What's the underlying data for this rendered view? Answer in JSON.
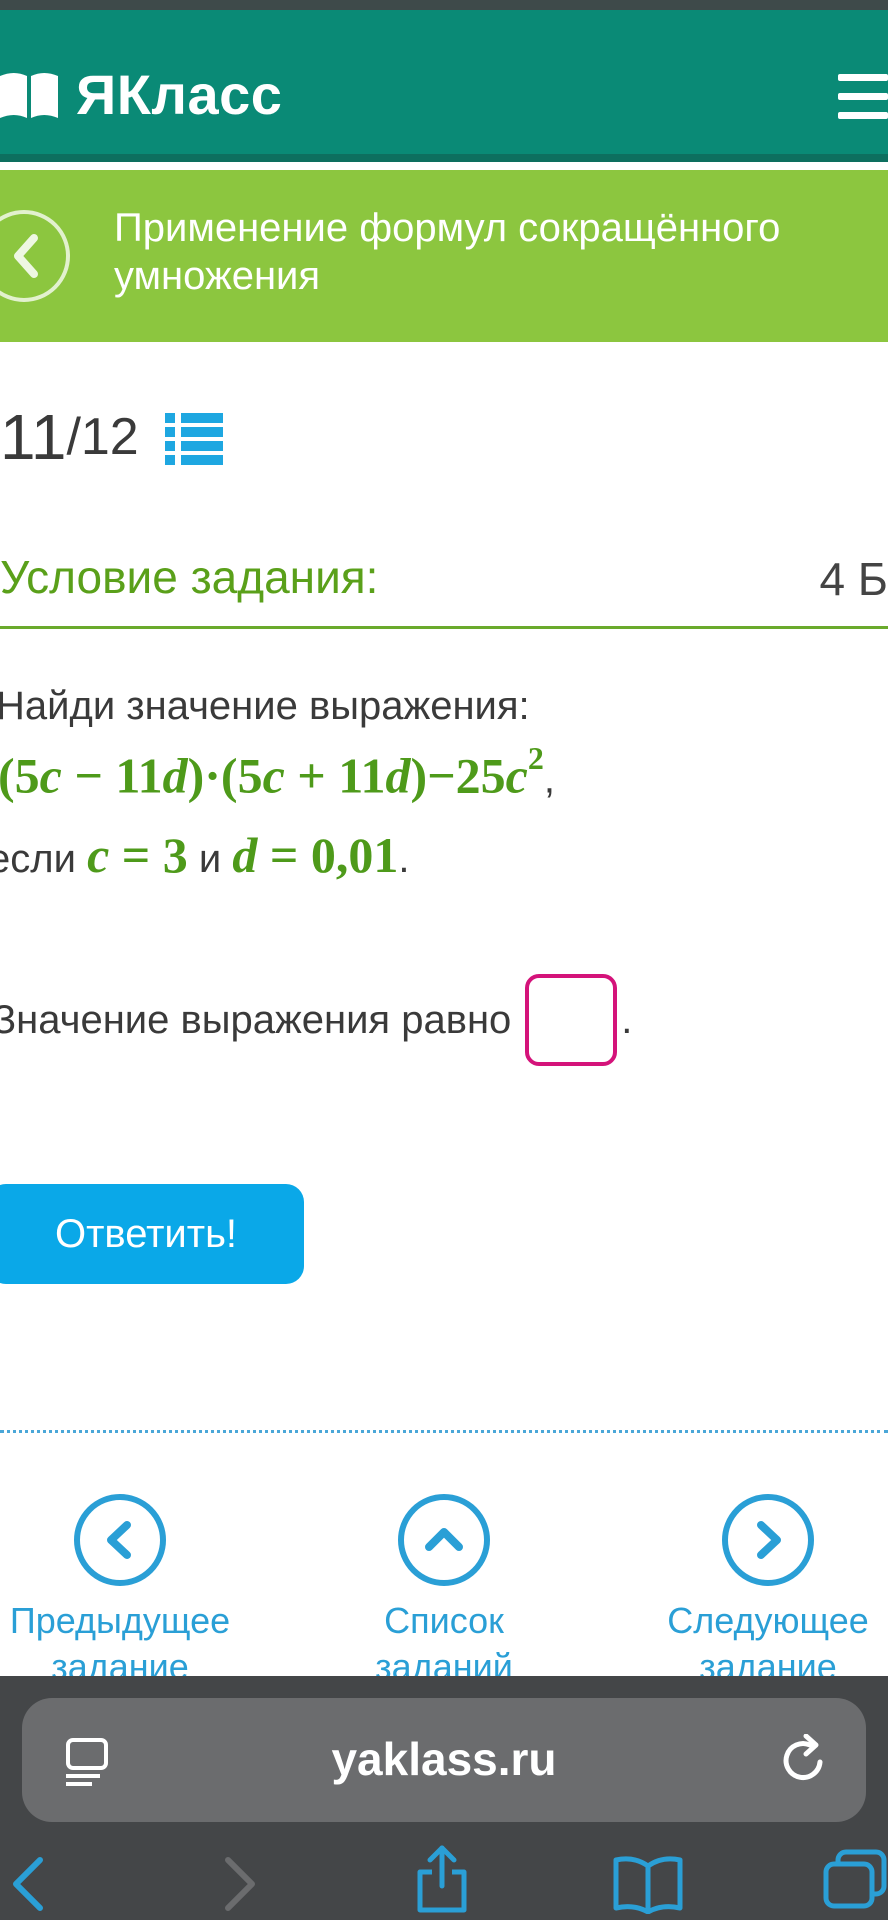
{
  "header": {
    "logo_text": "ЯКласс"
  },
  "topic": {
    "title": "Применение формул сокращённого умножения"
  },
  "counter": {
    "current": "11",
    "total": "/12"
  },
  "condition": {
    "title": "Условие задания:",
    "score": "4 Б"
  },
  "task": {
    "intro": "Найди значение выражения:",
    "expression_parts": [
      "(5",
      "c",
      " − 11",
      "d",
      ")·(5",
      "c",
      " + 11",
      "d",
      ")−25",
      "c",
      "2"
    ],
    "expression_comma": ",",
    "cond_prefix": "если",
    "cond_c_var": "c",
    "cond_c_rest": " = 3",
    "cond_and": "и",
    "cond_d_var": "d",
    "cond_d_rest": " = 0,01",
    "cond_end": "."
  },
  "answer": {
    "label": "Значение выражения равно",
    "suffix": "."
  },
  "submit_label": "Ответить!",
  "nav": {
    "prev": "Предыдущее задание",
    "list": "Список заданий",
    "next": "Следующее задание"
  },
  "browser": {
    "url": "yaklass.ru"
  },
  "colors": {
    "header": "#0a8a76",
    "topic": "#8cc63f",
    "accent_green": "#5aa01a",
    "link_blue": "#2a9fd6",
    "button_blue": "#0aa8e8",
    "answer_border": "#d4137a"
  },
  "icons": [
    "book-icon",
    "hamburger-icon",
    "back-circle-icon",
    "task-list-icon",
    "prev-icon",
    "up-icon",
    "next-icon",
    "reader-icon",
    "reload-icon",
    "back-arrow-icon",
    "forward-arrow-icon",
    "share-icon",
    "bookmarks-icon",
    "tabs-icon"
  ]
}
